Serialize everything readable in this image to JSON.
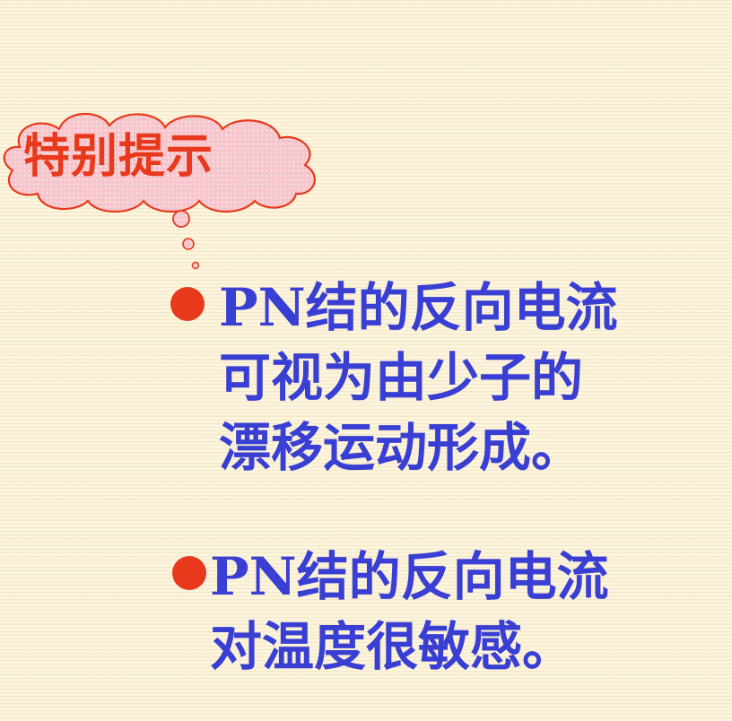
{
  "callout": {
    "title": "特别提示",
    "colors": {
      "title": "#e8391c",
      "fill": "#f6c6cc",
      "outline": "#e8391c"
    }
  },
  "tips": [
    {
      "lead": "PN",
      "lines": [
        "结的反向电流",
        "可视为由少子的",
        "漂移运动形成。"
      ]
    },
    {
      "lead": "PN",
      "lines": [
        "结的反向电流",
        "对温度很敏感。"
      ]
    }
  ],
  "colors": {
    "bullet": "#e8391c",
    "text": "#3a3fd4",
    "background": "#fcf4dc"
  }
}
